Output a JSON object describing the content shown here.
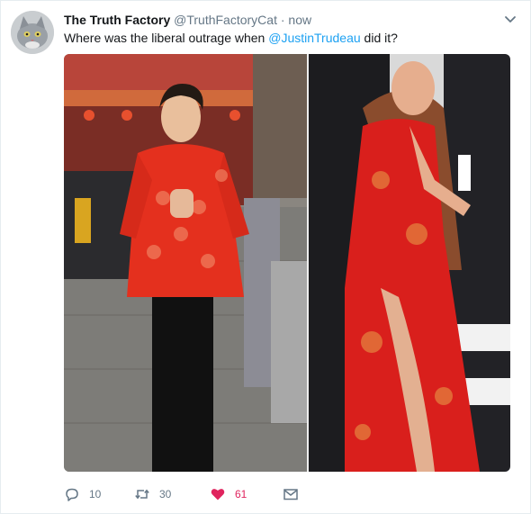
{
  "tweet": {
    "author_name": "The Truth Factory",
    "author_handle": "@TruthFactoryCat",
    "separator": "·",
    "timestamp": "now",
    "text_before": "Where was the liberal outrage when ",
    "mention": "@JustinTrudeau",
    "text_after": " did it?"
  },
  "actions": {
    "reply_count": "10",
    "retweet_count": "30",
    "like_count": "61"
  },
  "colors": {
    "link": "#1da1f2",
    "like": "#e0245e",
    "muted": "#657786"
  },
  "icons": {
    "reply": "reply-icon",
    "retweet": "retweet-icon",
    "like": "heart-icon",
    "dm": "envelope-icon",
    "menu": "chevron-down-icon"
  }
}
